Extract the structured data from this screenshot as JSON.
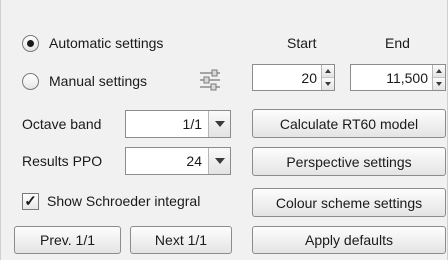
{
  "settings_mode": {
    "automatic_label": "Automatic settings",
    "manual_label": "Manual settings",
    "selected": "automatic"
  },
  "frequency_range": {
    "start_header": "Start",
    "end_header": "End",
    "start_value": "20",
    "end_value": "11,500"
  },
  "octave_band": {
    "label": "Octave band",
    "value": "1/1"
  },
  "results_ppo": {
    "label": "Results PPO",
    "value": "24"
  },
  "schroeder": {
    "label": "Show Schroeder integral",
    "checked": true,
    "check_glyph": "✓"
  },
  "buttons": {
    "calculate": "Calculate RT60 model",
    "perspective": "Perspective settings",
    "colour_scheme": "Colour scheme settings",
    "apply_defaults": "Apply defaults",
    "prev": "Prev. 1/1",
    "next": "Next 1/1"
  },
  "icons": {
    "manual_settings": "sliders-icon"
  }
}
